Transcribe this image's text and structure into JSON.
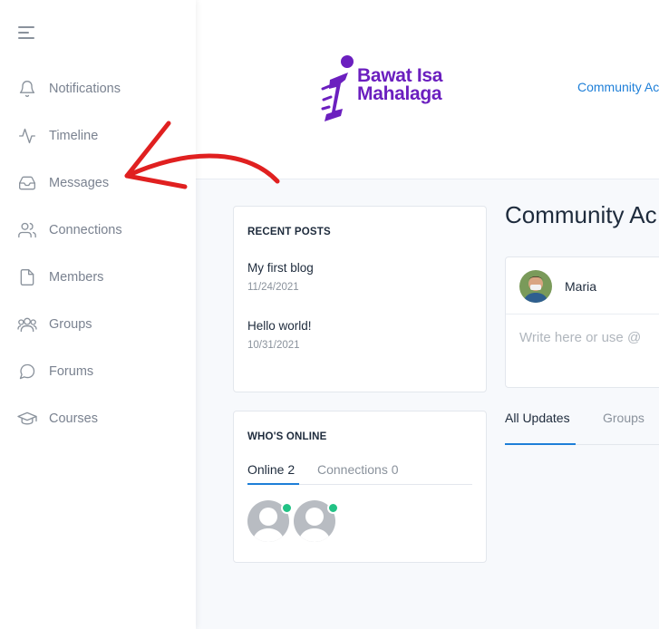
{
  "sidebar": {
    "items": [
      {
        "label": "Notifications",
        "icon": "bell-icon"
      },
      {
        "label": "Timeline",
        "icon": "activity-icon"
      },
      {
        "label": "Messages",
        "icon": "inbox-icon"
      },
      {
        "label": "Connections",
        "icon": "users-icon"
      },
      {
        "label": "Members",
        "icon": "document-icon"
      },
      {
        "label": "Groups",
        "icon": "group-icon"
      },
      {
        "label": "Forums",
        "icon": "chat-bubble-icon"
      },
      {
        "label": "Courses",
        "icon": "graduation-cap-icon"
      }
    ]
  },
  "header": {
    "logo_line1": "Bawat Isa",
    "logo_line2": "Mahalaga",
    "nav_link": "Community Ac"
  },
  "recent_posts": {
    "title": "RECENT POSTS",
    "posts": [
      {
        "title": "My first blog",
        "date": "11/24/2021"
      },
      {
        "title": "Hello world!",
        "date": "10/31/2021"
      }
    ]
  },
  "whos_online": {
    "title": "WHO'S ONLINE",
    "tab_online": "Online 2",
    "tab_connections": "Connections 0"
  },
  "main": {
    "title": "Community Ac",
    "user_name": "Maria",
    "composer_placeholder": "Write here or use @",
    "tabs": [
      {
        "label": "All Updates"
      },
      {
        "label": "Groups"
      }
    ]
  },
  "colors": {
    "brand_purple": "#6b1fbf",
    "link_blue": "#1e7fd8",
    "annotation_red": "#e02020",
    "online_green": "#22c285"
  }
}
